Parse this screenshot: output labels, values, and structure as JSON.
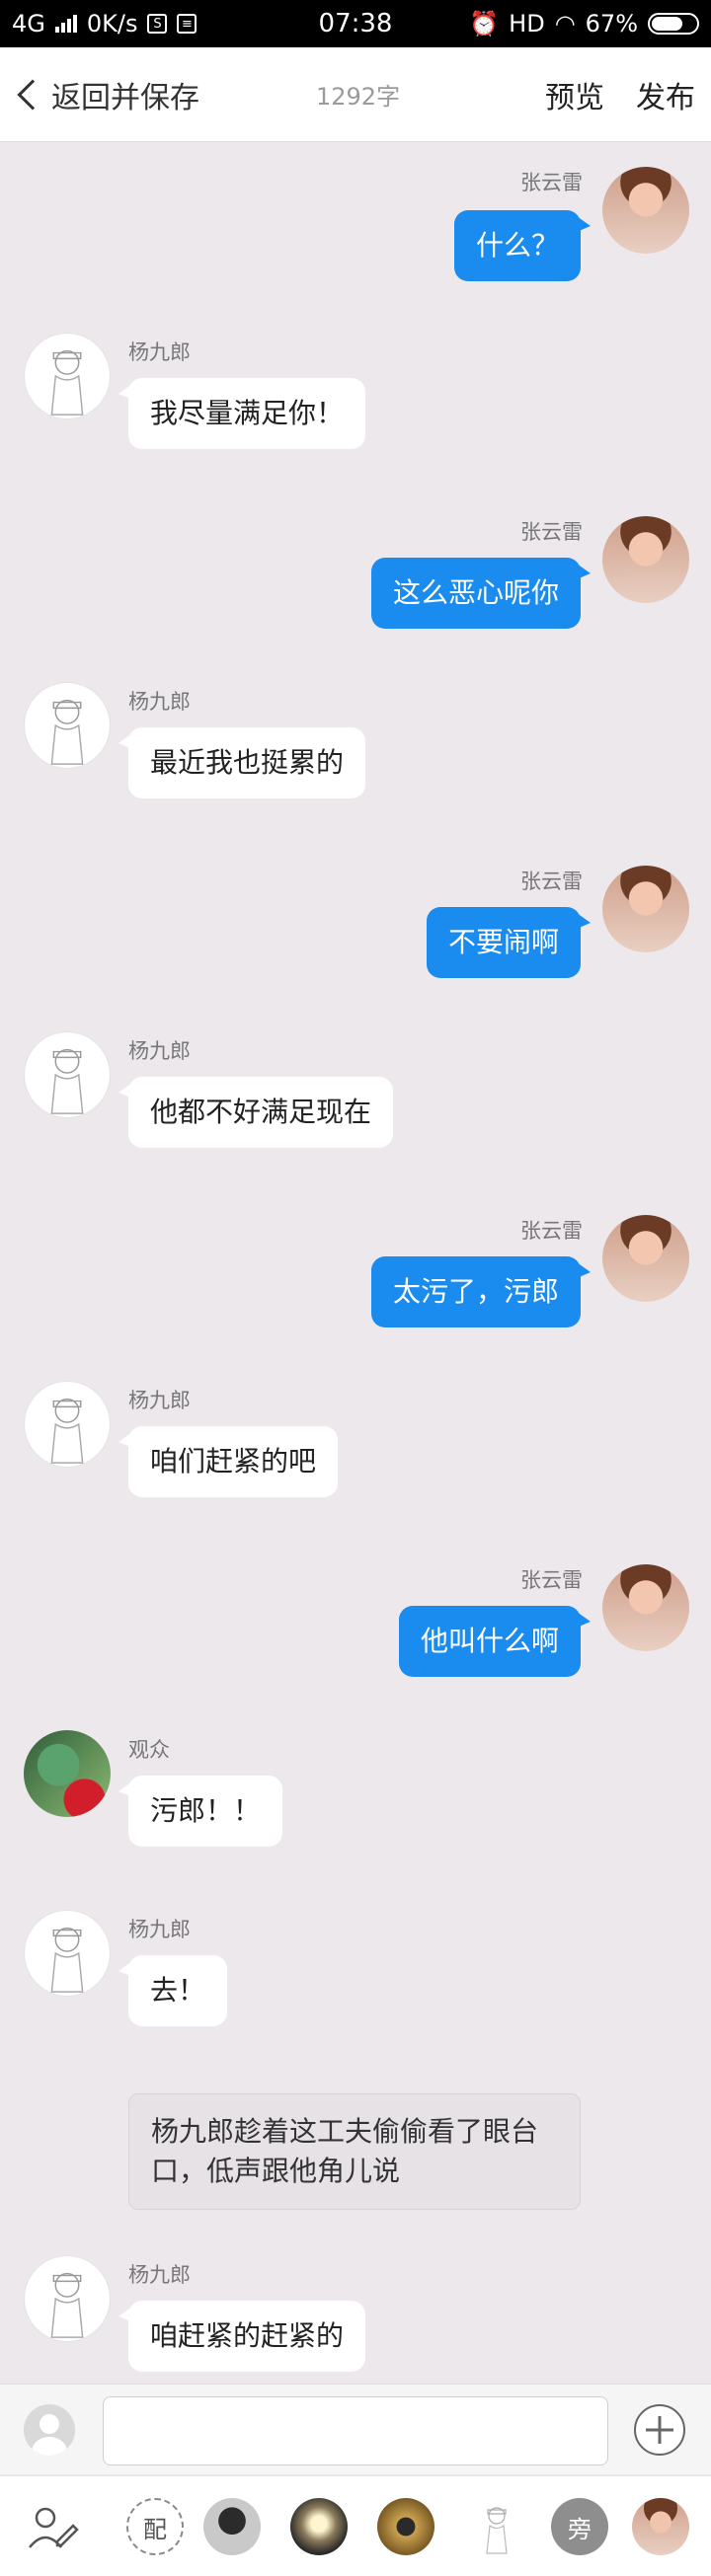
{
  "status_bar": {
    "network": "4G",
    "speed": "0K/s",
    "time": "07:38",
    "hd": "HD",
    "battery": "67%"
  },
  "header": {
    "back_label": "返回并保存",
    "word_count": "1292字",
    "preview_label": "预览",
    "publish_label": "发布"
  },
  "messages": [
    {
      "speaker": "张云雷",
      "text": "什么？"
    },
    {
      "speaker": "杨九郎",
      "text": "我尽量满足你！"
    },
    {
      "speaker": "张云雷",
      "text": "这么恶心呢你"
    },
    {
      "speaker": "杨九郎",
      "text": "最近我也挺累的"
    },
    {
      "speaker": "张云雷",
      "text": "不要闹啊"
    },
    {
      "speaker": "杨九郎",
      "text": "他都不好满足现在"
    },
    {
      "speaker": "张云雷",
      "text": "太污了，污郎"
    },
    {
      "speaker": "杨九郎",
      "text": "咱们赶紧的吧"
    },
    {
      "speaker": "张云雷",
      "text": "他叫什么啊"
    },
    {
      "speaker": "观众",
      "text": "污郎！！"
    },
    {
      "speaker": "杨九郎",
      "text": "去！"
    },
    {
      "narration_line1": "杨九郎趁着这工夫偷偷看了眼台",
      "narration_line2": "口，低声跟他角儿说"
    },
    {
      "speaker": "杨九郎",
      "text": "咱赶紧的赶紧的"
    }
  ],
  "input": {
    "placeholder": ""
  },
  "character_bar": {
    "pei_label": "配",
    "pang_label": "旁"
  },
  "colors": {
    "bubble_right": "#1a8cf0",
    "background": "#ede8ec"
  }
}
